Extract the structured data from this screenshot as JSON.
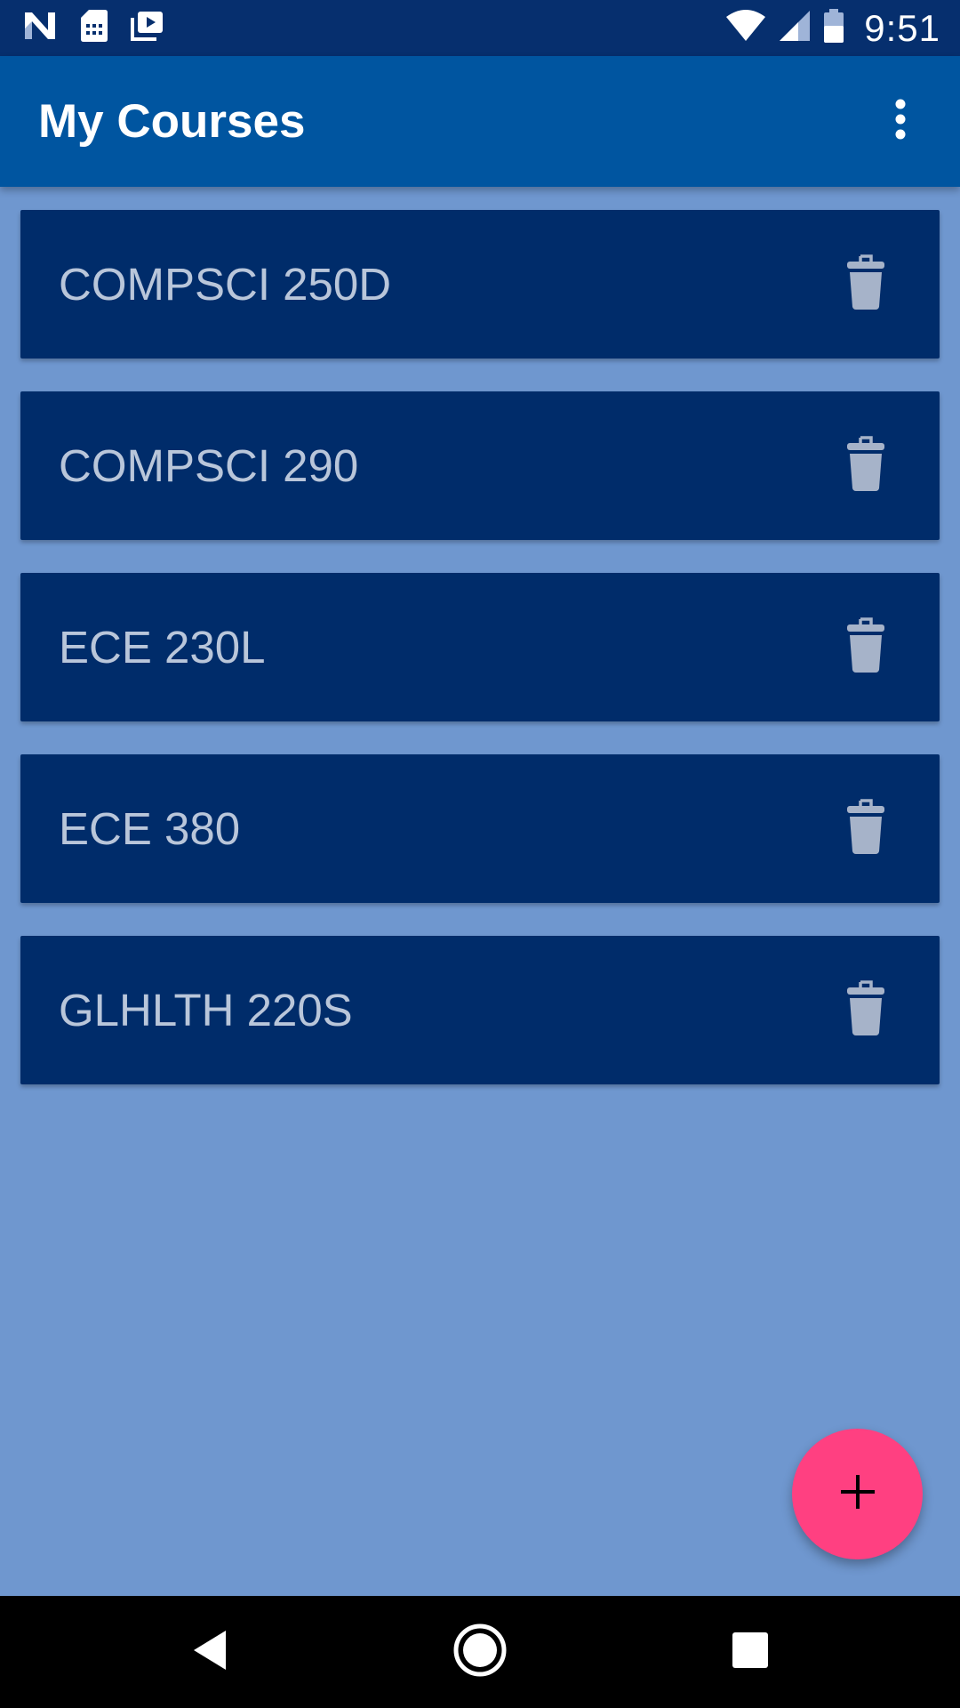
{
  "status_bar": {
    "time": "9:51",
    "icons": [
      "notification-n-icon",
      "sim-card-icon",
      "media-queue-icon",
      "wifi-icon",
      "cell-signal-icon",
      "battery-icon"
    ]
  },
  "app_bar": {
    "title": "My Courses",
    "overflow_icon": "more-vert-icon"
  },
  "courses": [
    {
      "name": "COMPSCI 250D"
    },
    {
      "name": "COMPSCI 290"
    },
    {
      "name": "ECE 230L"
    },
    {
      "name": "ECE 380"
    },
    {
      "name": "GLHLTH 220S"
    }
  ],
  "fab": {
    "icon": "plus-icon",
    "symbol": "+"
  },
  "nav_bar": {
    "icons": [
      "back-icon",
      "home-icon",
      "recents-icon"
    ]
  },
  "colors": {
    "status_bar": "#062f6e",
    "app_bar": "#0055a0",
    "background": "#6f97cf",
    "card": "#002c6a",
    "card_text": "#b9c6da",
    "trash_icon": "#a6b3c9",
    "fab": "#ff4081",
    "fab_icon": "#000000",
    "nav_bar": "#000000"
  }
}
